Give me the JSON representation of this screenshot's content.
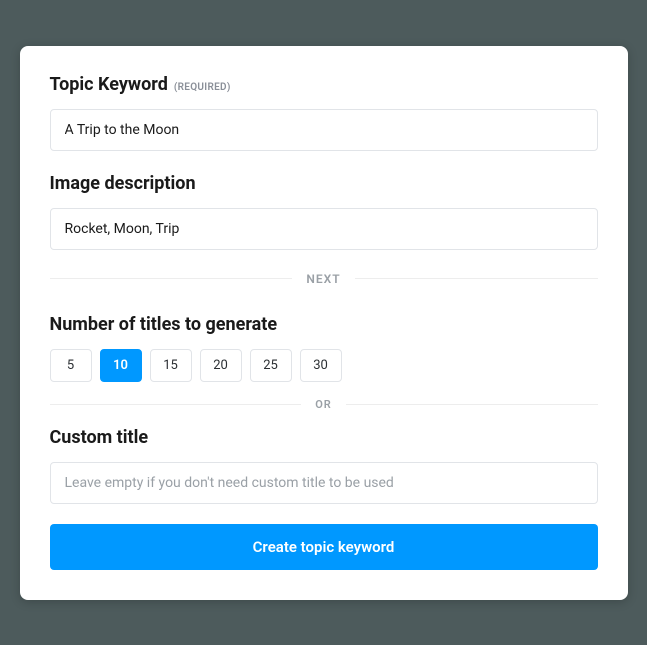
{
  "fields": {
    "topic_keyword": {
      "label": "Topic Keyword",
      "required_tag": "(REQUIRED)",
      "value": "A Trip to the Moon"
    },
    "image_description": {
      "label": "Image description",
      "value": "Rocket, Moon, Trip"
    },
    "custom_title": {
      "label": "Custom title",
      "placeholder": "Leave empty if you don't need custom title to be used"
    }
  },
  "dividers": {
    "next": "NEXT",
    "or": "OR"
  },
  "titles_section": {
    "label": "Number of titles to generate",
    "options": [
      "5",
      "10",
      "15",
      "20",
      "25",
      "30"
    ],
    "selected": "10"
  },
  "submit": {
    "label": "Create topic keyword"
  },
  "colors": {
    "accent": "#0098ff"
  }
}
